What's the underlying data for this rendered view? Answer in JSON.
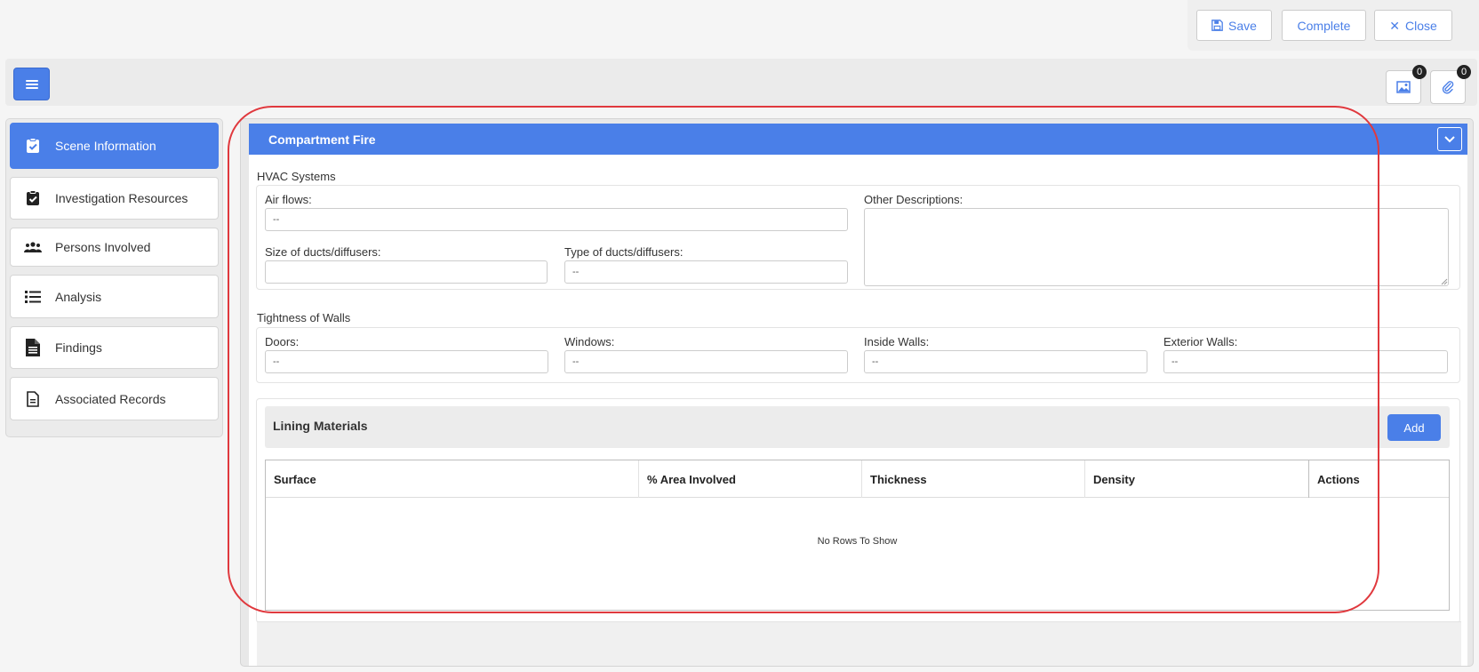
{
  "top_actions": {
    "save": "Save",
    "complete": "Complete",
    "close": "Close"
  },
  "toolbar": {
    "images_count": "0",
    "attachments_count": "0"
  },
  "sidebar": {
    "items": [
      {
        "label": "Scene Information",
        "icon": "clipboard-check-icon",
        "active": true
      },
      {
        "label": "Investigation Resources",
        "icon": "clipboard-check-icon",
        "active": false
      },
      {
        "label": "Persons Involved",
        "icon": "users-icon",
        "active": false
      },
      {
        "label": "Analysis",
        "icon": "list-icon",
        "active": false
      },
      {
        "label": "Findings",
        "icon": "file-text-icon",
        "active": false
      },
      {
        "label": "Associated Records",
        "icon": "file-icon",
        "active": false
      }
    ]
  },
  "section": {
    "title": "Compartment Fire",
    "hvac": {
      "title": "HVAC Systems",
      "air_flows_label": "Air flows:",
      "air_flows_value": "--",
      "size_label": "Size of ducts/diffusers:",
      "size_value": "",
      "type_label": "Type of ducts/diffusers:",
      "type_value": "--",
      "other_label": "Other Descriptions:",
      "other_value": ""
    },
    "walls": {
      "title": "Tightness of Walls",
      "doors_label": "Doors:",
      "doors_value": "--",
      "windows_label": "Windows:",
      "windows_value": "--",
      "inside_label": "Inside Walls:",
      "inside_value": "--",
      "exterior_label": "Exterior Walls:",
      "exterior_value": "--"
    },
    "lining": {
      "title": "Lining Materials",
      "add_label": "Add",
      "columns": [
        "Surface",
        "% Area Involved",
        "Thickness",
        "Density",
        "Actions"
      ],
      "empty_message": "No Rows To Show"
    }
  },
  "colors": {
    "accent": "#4a7fe8",
    "highlight": "#e0393e"
  }
}
